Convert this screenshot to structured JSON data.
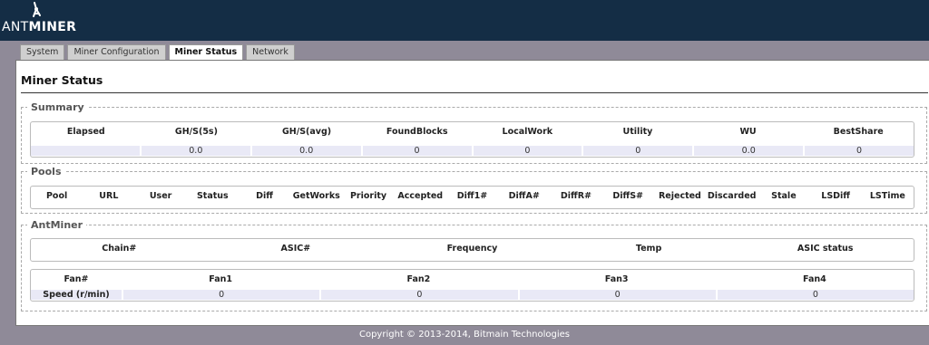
{
  "brand": {
    "prefix": "ANT",
    "suffix": "MINER"
  },
  "tabs": [
    {
      "label": "System"
    },
    {
      "label": "Miner Configuration"
    },
    {
      "label": "Miner Status",
      "active": true
    },
    {
      "label": "Network"
    }
  ],
  "page_title": "Miner Status",
  "summary": {
    "legend": "Summary",
    "headers": [
      "Elapsed",
      "GH/S(5s)",
      "GH/S(avg)",
      "FoundBlocks",
      "LocalWork",
      "Utility",
      "WU",
      "BestShare"
    ],
    "values": [
      "",
      "0.0",
      "0.0",
      "0",
      "0",
      "0",
      "0.0",
      "0"
    ]
  },
  "pools": {
    "legend": "Pools",
    "headers": [
      "Pool",
      "URL",
      "User",
      "Status",
      "Diff",
      "GetWorks",
      "Priority",
      "Accepted",
      "Diff1#",
      "DiffA#",
      "DiffR#",
      "DiffS#",
      "Rejected",
      "Discarded",
      "Stale",
      "LSDiff",
      "LSTime"
    ]
  },
  "antminer": {
    "legend": "AntMiner",
    "chain_headers": [
      "Chain#",
      "ASIC#",
      "Frequency",
      "Temp",
      "ASIC status"
    ],
    "fan_headers": [
      "Fan#",
      "Fan1",
      "Fan2",
      "Fan3",
      "Fan4"
    ],
    "fan_row_label": "Speed (r/min)",
    "fan_speeds": [
      "0",
      "0",
      "0",
      "0"
    ]
  },
  "footer": "Copyright © 2013-2014, Bitmain Technologies",
  "colors": {
    "topbar": "#142d45",
    "background": "#8f8a98",
    "value_row": "#e9e9f6"
  }
}
